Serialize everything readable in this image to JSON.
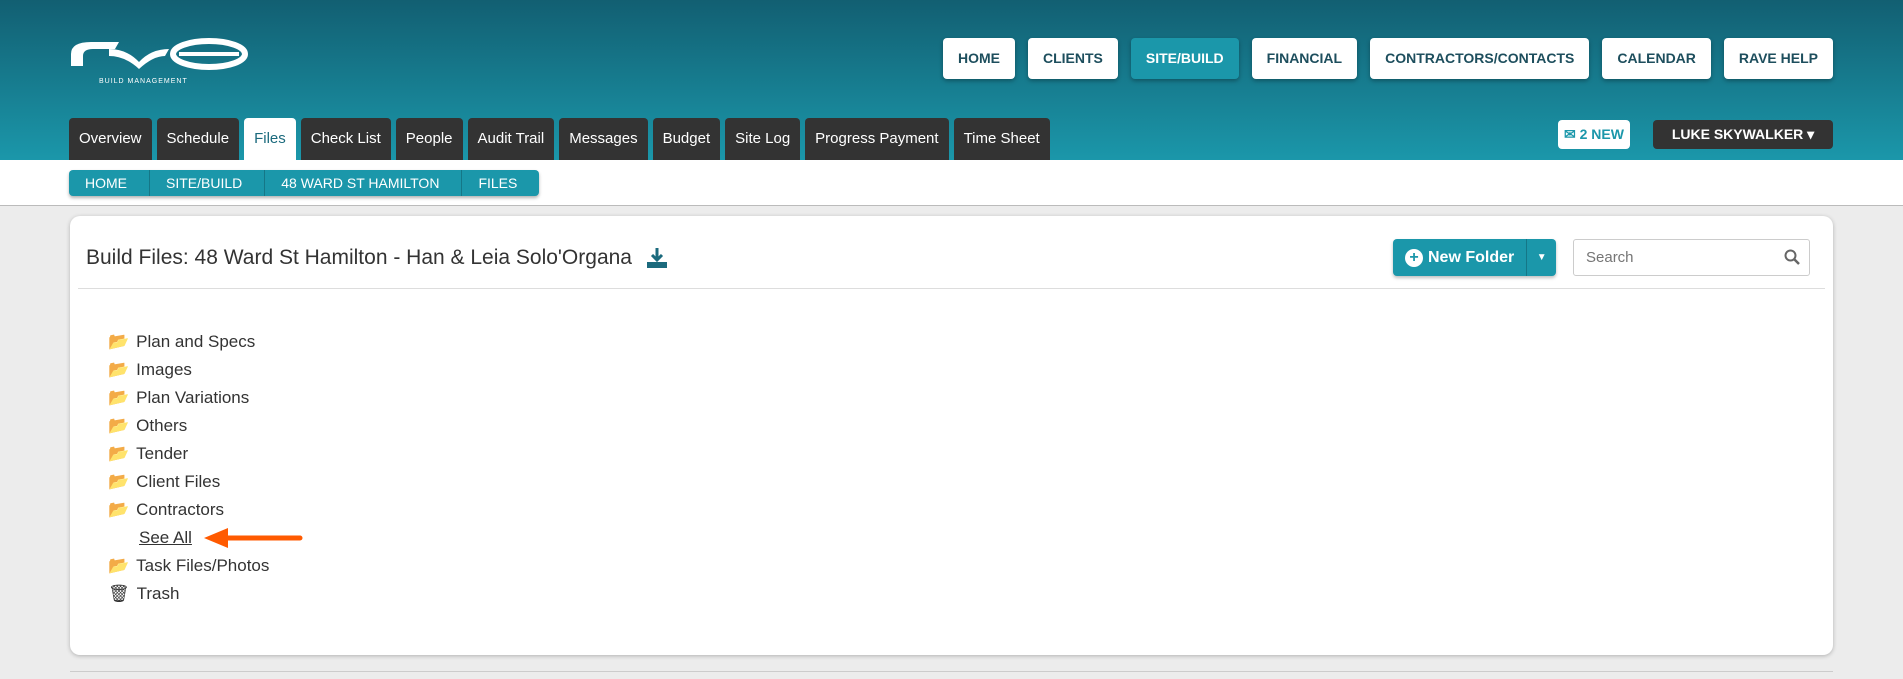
{
  "logo": {
    "text": "rave",
    "subtitle": "BUILD MANAGEMENT"
  },
  "nav": [
    {
      "label": "HOME"
    },
    {
      "label": "CLIENTS"
    },
    {
      "label": "SITE/BUILD",
      "active": true
    },
    {
      "label": "FINANCIAL"
    },
    {
      "label": "CONTRACTORS/CONTACTS"
    },
    {
      "label": "CALENDAR"
    },
    {
      "label": "RAVE HELP"
    }
  ],
  "tabs": [
    {
      "label": "Overview"
    },
    {
      "label": "Schedule"
    },
    {
      "label": "Files",
      "active": true
    },
    {
      "label": "Check List"
    },
    {
      "label": "People"
    },
    {
      "label": "Audit Trail"
    },
    {
      "label": "Messages"
    },
    {
      "label": "Budget"
    },
    {
      "label": "Site Log"
    },
    {
      "label": "Progress Payment"
    },
    {
      "label": "Time Sheet"
    }
  ],
  "messages": {
    "label": "2 NEW"
  },
  "user": {
    "name": "LUKE SKYWALKER"
  },
  "breadcrumb": [
    "HOME",
    "SITE/BUILD",
    "48 WARD ST HAMILTON",
    "FILES"
  ],
  "main": {
    "title": "Build Files: 48 Ward St Hamilton - Han & Leia Solo'Organa",
    "new_folder": "New Folder",
    "search_placeholder": "Search",
    "folders": [
      {
        "label": "Plan and Specs"
      },
      {
        "label": "Images"
      },
      {
        "label": "Plan Variations"
      },
      {
        "label": "Others"
      },
      {
        "label": "Tender"
      },
      {
        "label": "Client Files"
      },
      {
        "label": "Contractors"
      }
    ],
    "see_all": "See All",
    "folders_after": [
      {
        "label": "Task Files/Photos"
      }
    ],
    "trash": "Trash"
  },
  "colors": {
    "accent": "#1b97aa",
    "arrow": "#ff5a00"
  }
}
